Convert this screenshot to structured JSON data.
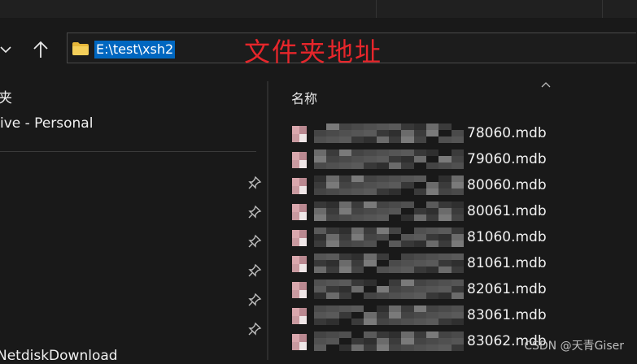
{
  "toolbar": {
    "back_icon": "chevron-down-icon",
    "up_icon": "up-arrow-icon"
  },
  "address": {
    "path": "E:\\test\\xsh2",
    "annotation": "文件夹地址"
  },
  "sidebar": {
    "items": [
      {
        "label": "夹"
      },
      {
        "label": "ive - Personal"
      },
      {
        "label": "NetdiskDownload"
      }
    ],
    "pinned_count": 6
  },
  "content": {
    "column_header": "名称",
    "files": [
      {
        "name": "78060.mdb"
      },
      {
        "name": "79060.mdb"
      },
      {
        "name": "80060.mdb"
      },
      {
        "name": "80061.mdb"
      },
      {
        "name": "81060.mdb"
      },
      {
        "name": "81061.mdb"
      },
      {
        "name": "82061.mdb"
      },
      {
        "name": "83061.mdb"
      },
      {
        "name": "83062.mdb"
      }
    ]
  },
  "watermark": "CSDN @天青Giser",
  "colors": {
    "background": "#191919",
    "selection": "#0067c0",
    "annotation": "#e6262b",
    "folder": "#f2c94c"
  }
}
